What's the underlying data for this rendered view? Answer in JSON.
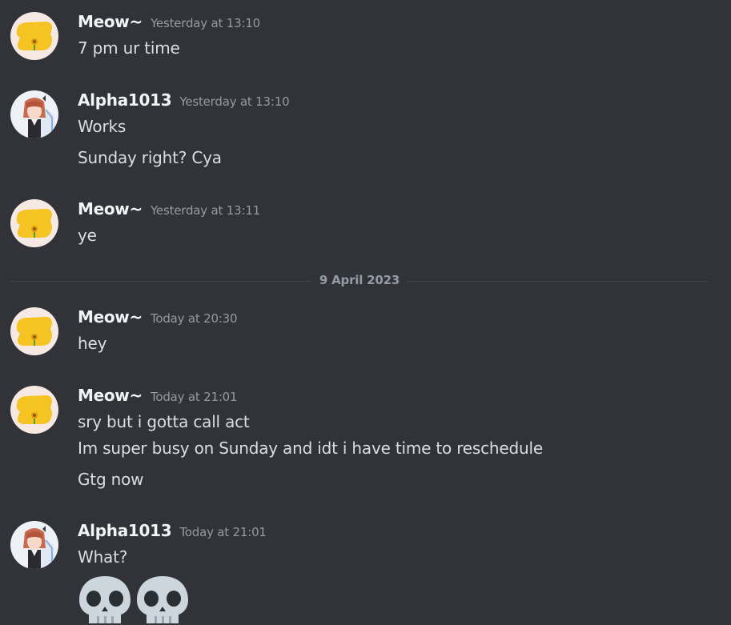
{
  "messages": [
    {
      "username": "Meow~",
      "timestamp": "Yesterday at 13:10",
      "avatar": "sunflower-avatar",
      "lines": [
        "7 pm ur time"
      ]
    },
    {
      "username": "Alpha1013",
      "timestamp": "Yesterday at 13:10",
      "avatar": "anime-girl-avatar",
      "lines": [
        "Works",
        "Sunday right? Cya"
      ]
    },
    {
      "username": "Meow~",
      "timestamp": "Yesterday at 13:11",
      "avatar": "sunflower-avatar",
      "lines": [
        "ye"
      ]
    },
    {
      "username": "Meow~",
      "timestamp": "Today at 20:30",
      "avatar": "sunflower-avatar",
      "lines": [
        "hey"
      ]
    },
    {
      "username": "Meow~",
      "timestamp": "Today at 21:01",
      "avatar": "sunflower-avatar",
      "lines": [
        "sry but i gotta call act",
        "Im super busy on Sunday and idt i have time to reschedule",
        "Gtg now"
      ]
    },
    {
      "username": "Alpha1013",
      "timestamp": "Today at 21:01",
      "avatar": "anime-girl-avatar",
      "lines": [
        "What?"
      ],
      "emojis": [
        "skull-emoji",
        "skull-emoji"
      ]
    }
  ],
  "date_divider": "9 April 2023",
  "colors": {
    "background": "#313338",
    "username": "#f2f3f5",
    "timestamp": "#949ba4",
    "text": "#dbdee1",
    "divider": "#3f4147"
  }
}
